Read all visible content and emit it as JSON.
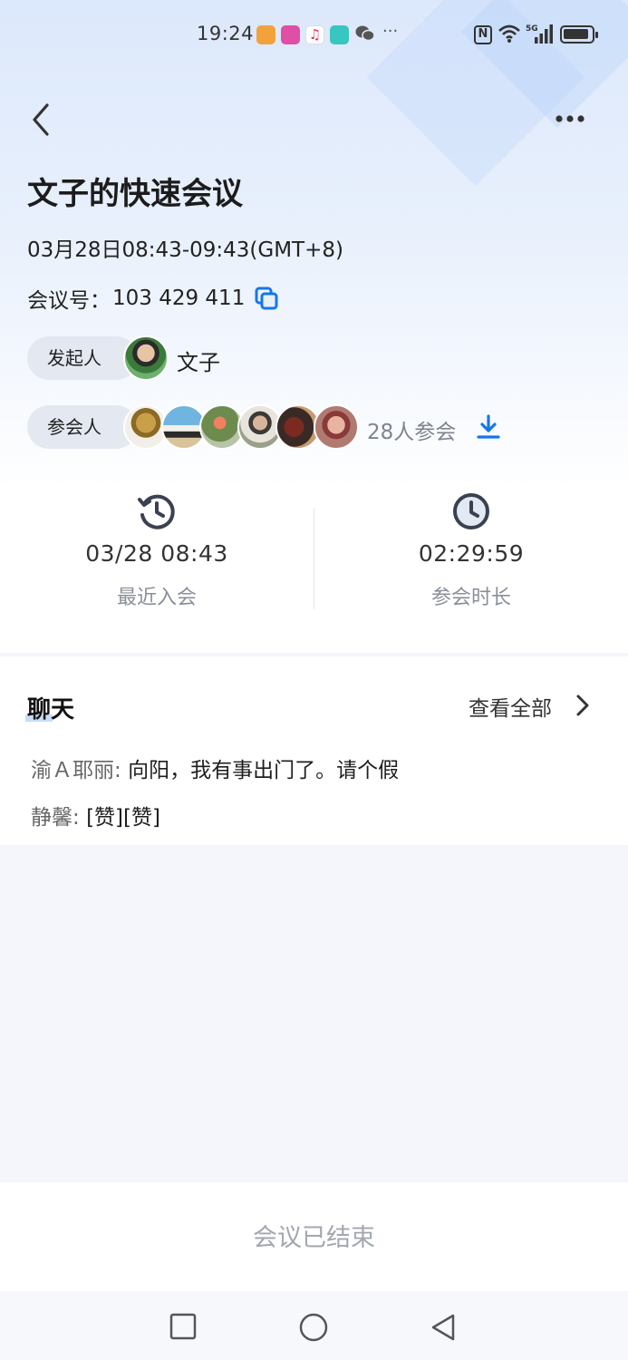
{
  "status_bar": {
    "time": "19:24",
    "app_icons": [
      "shield-app-icon",
      "video-app-icon",
      "music-app-icon",
      "book-app-icon"
    ],
    "wechat_icon": "wechat-icon",
    "more": "···",
    "nfc": "N",
    "network": "5G",
    "battery_level": 0.9
  },
  "header": {
    "back_icon": "back-arrow-icon",
    "menu_icon": "more-icon"
  },
  "meeting": {
    "title": "文子的快速会议",
    "time_range": "03月28日08:43-09:43(GMT+8)",
    "id_label": "会议号：",
    "id_value": "103 429 411",
    "host_label": "发起人",
    "host_name": "文子",
    "participants_label": "参会人",
    "participants_count_text": "28人参会"
  },
  "stats": {
    "recent_join_value": "03/28 08:43",
    "recent_join_label": "最近入会",
    "duration_value": "02:29:59",
    "duration_label": "参会时长"
  },
  "chat": {
    "title": "聊天",
    "view_all": "查看全部",
    "messages": [
      {
        "sender": "渝Ａ耶丽: ",
        "text": "向阳，我有事出门了。请个假"
      },
      {
        "sender": "静馨: ",
        "text": "[赞][赞]"
      }
    ]
  },
  "footer": {
    "status": "会议已结束"
  },
  "colors": {
    "accent": "#1677e6",
    "text_muted": "#8a8f99",
    "header_gradient_top": "#dce8fb"
  }
}
